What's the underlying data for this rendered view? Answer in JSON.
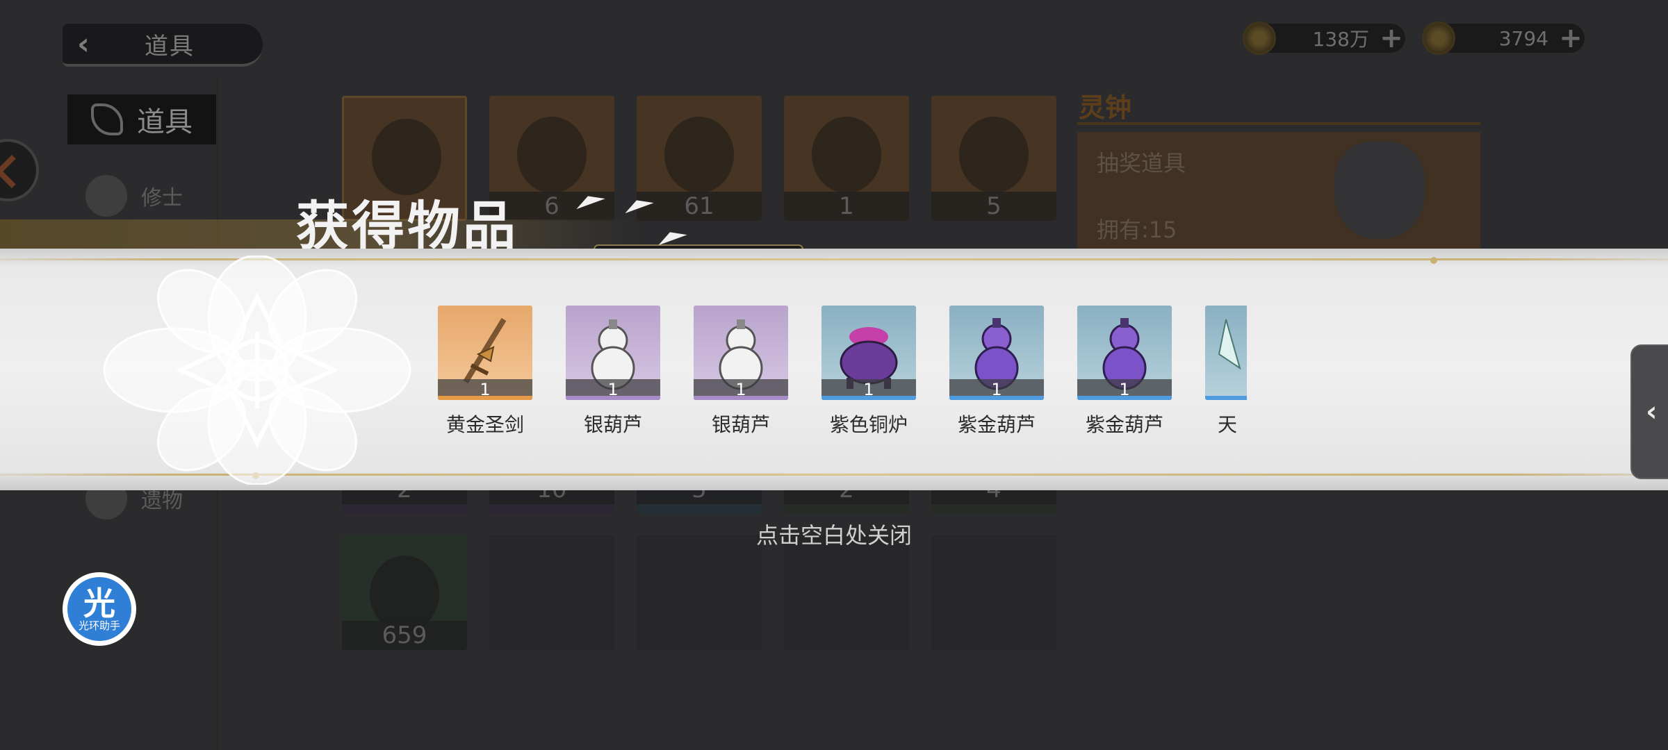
{
  "header": {
    "back_label": "道具"
  },
  "currencies": [
    {
      "name": "coin",
      "amount": "138万",
      "plus": "+"
    },
    {
      "name": "jade",
      "amount": "3794",
      "plus": "+"
    }
  ],
  "sidebar": {
    "items": [
      {
        "label": "道具",
        "active": true
      },
      {
        "label": "修士",
        "active": false
      },
      {
        "label": "遗物",
        "active": false
      }
    ]
  },
  "inventory": {
    "row1": [
      {
        "count": "",
        "color": "#6a4a2a"
      },
      {
        "count": "6",
        "color": "#6a4a2a"
      },
      {
        "count": "61",
        "color": "#6a4a2a"
      },
      {
        "count": "1",
        "color": "#6a4a2a"
      },
      {
        "count": "5",
        "color": "#6a4a2a"
      }
    ],
    "row2": [
      {
        "count": "2",
        "color": "#3d3347"
      },
      {
        "count": "10",
        "color": "#3d3347"
      },
      {
        "count": "5",
        "color": "#2f3f4a"
      },
      {
        "count": "2",
        "color": "#333d2f"
      },
      {
        "count": "4",
        "color": "#333d2f"
      }
    ],
    "row3": [
      {
        "count": "659",
        "color": "#354236"
      }
    ]
  },
  "detail": {
    "title": "灵钟",
    "category": "抽奖道具",
    "owned": "拥有:15"
  },
  "reward_popup": {
    "title": "获得物品",
    "items": [
      {
        "name": "黄金圣剑",
        "qty": "1",
        "icon": "golden-sword-icon",
        "bg_top": "#e6a76a",
        "bg_bottom": "#f4c99c",
        "stripe": "#e59a48"
      },
      {
        "name": "银葫芦",
        "qty": "1",
        "icon": "silver-gourd-icon",
        "bg_top": "#b9a3cc",
        "bg_bottom": "#d8c8e4",
        "stripe": "#a88cc7"
      },
      {
        "name": "银葫芦",
        "qty": "1",
        "icon": "silver-gourd-icon",
        "bg_top": "#b9a3cc",
        "bg_bottom": "#d8c8e4",
        "stripe": "#a88cc7"
      },
      {
        "name": "紫色铜炉",
        "qty": "1",
        "icon": "purple-cauldron-icon",
        "bg_top": "#8ab0c2",
        "bg_bottom": "#b8d2dc",
        "stripe": "#4f9be0"
      },
      {
        "name": "紫金葫芦",
        "qty": "1",
        "icon": "purple-gourd-icon",
        "bg_top": "#8ab0c2",
        "bg_bottom": "#b8d2dc",
        "stripe": "#4f9be0"
      },
      {
        "name": "紫金葫芦",
        "qty": "1",
        "icon": "purple-gourd-icon",
        "bg_top": "#8ab0c2",
        "bg_bottom": "#b8d2dc",
        "stripe": "#4f9be0"
      },
      {
        "name": "天",
        "qty": "",
        "icon": "sky-item-icon",
        "bg_top": "#8ab0c2",
        "bg_bottom": "#b8d2dc",
        "stripe": "#4f9be0"
      }
    ],
    "close_hint": "点击空白处关闭"
  },
  "assistant": {
    "big": "光",
    "small": "光环助手"
  }
}
